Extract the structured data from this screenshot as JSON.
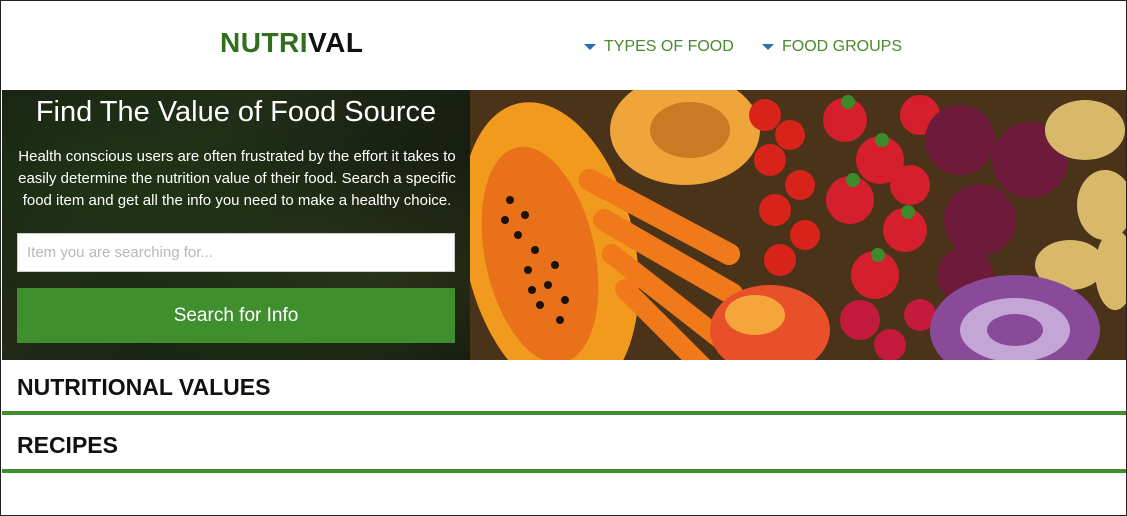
{
  "header": {
    "logo_part1": "NUTRI",
    "logo_part2": "VAL",
    "nav": [
      {
        "label": "TYPES OF FOOD",
        "icon": "caret-down-icon"
      },
      {
        "label": "FOOD GROUPS",
        "icon": "caret-down-icon"
      }
    ]
  },
  "hero": {
    "title": "Find The Value of Food Source",
    "description": "Health conscious users are often frustrated by the effort it takes to easily determine the nutrition value of their food. Search a specific food item and get all the info you need to make a healthy choice.",
    "search_placeholder": "Item you are searching for...",
    "search_button": "Search for Info"
  },
  "sections": [
    {
      "label": "NUTRITIONAL VALUES"
    },
    {
      "label": "RECIPES"
    }
  ],
  "colors": {
    "brand_green": "#3f8f2f",
    "logo_green": "#2f6f1e",
    "nav_green": "#4a8a2c",
    "caret_blue": "#2a6fa8"
  }
}
